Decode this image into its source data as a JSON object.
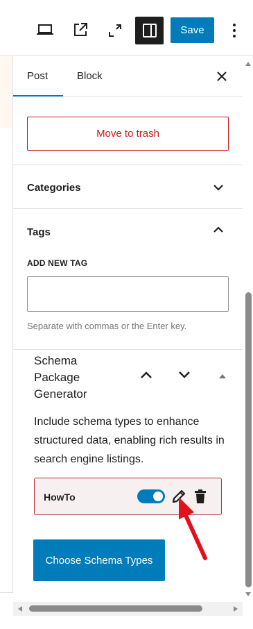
{
  "toolbar": {
    "save_label": "Save",
    "icons": [
      "desktop-preview-icon",
      "external-link-icon",
      "fullscreen-icon",
      "sidebar-toggle-icon",
      "more-options-icon"
    ]
  },
  "sidebar": {
    "tabs": [
      {
        "label": "Post",
        "active": true
      },
      {
        "label": "Block",
        "active": false
      }
    ],
    "trash_label": "Move to trash",
    "categories_title": "Categories",
    "tags": {
      "title": "Tags",
      "add_label": "ADD NEW TAG",
      "input_value": "",
      "help": "Separate with commas or the Enter key."
    },
    "schema": {
      "title": "Schema Package Generator",
      "description": "Include schema types to enhance structured data, enabling rich results in search engine listings.",
      "items": [
        {
          "label": "HowTo",
          "enabled": true
        }
      ],
      "choose_label": "Choose Schema Types"
    }
  },
  "colors": {
    "accent": "#007cba",
    "danger": "#cc1818",
    "annotation_arrow": "#e0121b"
  }
}
